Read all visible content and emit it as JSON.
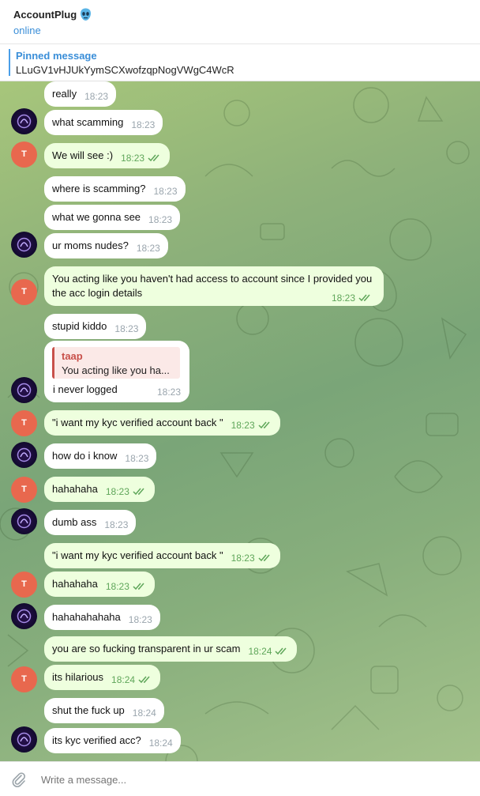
{
  "header": {
    "title": "AccountPlug",
    "status": "online",
    "title_emoji_icon": "alien-mask-icon"
  },
  "pinned": {
    "title": "Pinned message",
    "text": "LLuGV1vHJUkYymSCXwofzqpNogVWgC4WcR"
  },
  "messages": [
    {
      "text": "really",
      "time": "18:23",
      "outgoing": false
    },
    {
      "text": "what scamming",
      "time": "18:23",
      "outgoing": false
    },
    {
      "text": "We will see :)",
      "time": "18:23",
      "outgoing": true
    },
    {
      "text": "where is scamming?",
      "time": "18:23",
      "outgoing": false
    },
    {
      "text": "what we gonna see",
      "time": "18:23",
      "outgoing": false
    },
    {
      "text": "ur moms nudes?",
      "time": "18:23",
      "outgoing": false
    },
    {
      "text": "You acting like you haven't had access to account since I provided you the acc login details",
      "time": "18:23",
      "outgoing": true
    },
    {
      "text": "stupid kiddo",
      "time": "18:23",
      "outgoing": false
    },
    {
      "text": "i never logged",
      "time": "18:23",
      "outgoing": false,
      "reply_name": "taap",
      "reply_text": "You acting like you ha..."
    },
    {
      "text": "\"i want my kyc verified account back \"",
      "time": "18:23",
      "outgoing": true
    },
    {
      "text": "how do i know",
      "time": "18:23",
      "outgoing": false
    },
    {
      "text": "hahahaha",
      "time": "18:23",
      "outgoing": true
    },
    {
      "text": "dumb ass",
      "time": "18:23",
      "outgoing": false
    },
    {
      "text": "\"i want my kyc verified account back \"",
      "time": "18:23",
      "outgoing": true
    },
    {
      "text": "hahahaha",
      "time": "18:23",
      "outgoing": true
    },
    {
      "text": "hahahahahaha",
      "time": "18:23",
      "outgoing": false
    },
    {
      "text": "you are so fucking transparent in ur scam",
      "time": "18:24",
      "outgoing": true
    },
    {
      "text": "its hilarious",
      "time": "18:24",
      "outgoing": true
    },
    {
      "text": "shut the fuck up",
      "time": "18:24",
      "outgoing": false
    },
    {
      "text": "its kyc verified acc?",
      "time": "18:24",
      "outgoing": false
    }
  ],
  "avatar_t_initial": "T",
  "composer": {
    "placeholder": "Write a message..."
  },
  "colors": {
    "accent": "#3a8ed8",
    "outgoing_bubble": "#eeffde",
    "avatar_t": "#e8684e",
    "reply_accent": "#c8504a"
  }
}
